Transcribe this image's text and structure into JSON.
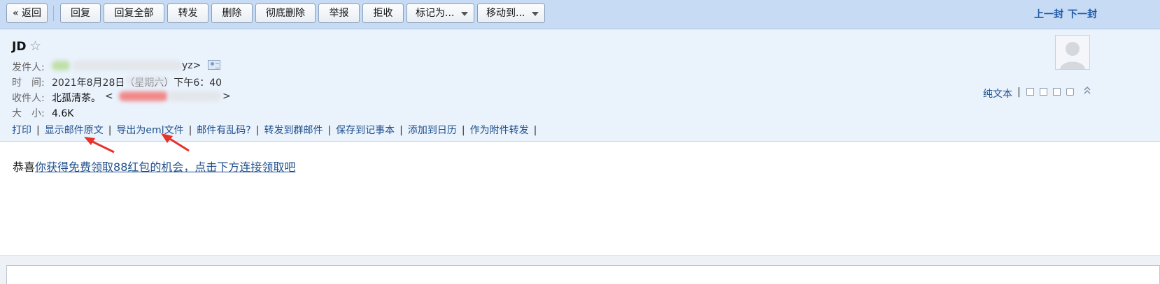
{
  "toolbar": {
    "back": "« 返回",
    "reply": "回复",
    "reply_all": "回复全部",
    "forward": "转发",
    "delete": "删除",
    "delete_permanently": "彻底删除",
    "report": "举报",
    "reject": "拒收",
    "mark_as": "标记为...",
    "move_to": "移动到...",
    "prev": "上一封",
    "next": "下一封"
  },
  "mail": {
    "subject": "JD",
    "star": "☆",
    "from_label": "发件人:",
    "from_visible": "yz>",
    "time_label": "时　间:",
    "time_value": "2021年8月28日（星期六）下午6：40",
    "to_label": "收件人:",
    "to_name": "北孤清茶。",
    "to_lt": "<",
    "to_gt": ">",
    "size_label": "大　小:",
    "size_value": "4.6K"
  },
  "actions": [
    "打印",
    "显示邮件原文",
    "导出为eml文件",
    "邮件有乱码?",
    "转发到群邮件",
    "保存到记事本",
    "添加到日历",
    "作为附件转发"
  ],
  "side": {
    "plain_text": "纯文本",
    "bar": "|"
  },
  "body": {
    "prefix": "恭喜",
    "link": "你获得免费领取88红包的机会，点击下方连接领取吧"
  },
  "icons": [
    "star-icon",
    "contact-card-icon",
    "avatar-icon",
    "new-window-icon",
    "print-icon",
    "collapse-icon",
    "caret-down-icon"
  ],
  "colors": {
    "toolbar_bg": "#c7dcf4",
    "header_bg": "#eaf2fc",
    "link": "#1e4f8c",
    "annotation_arrow": "#e8312b"
  }
}
